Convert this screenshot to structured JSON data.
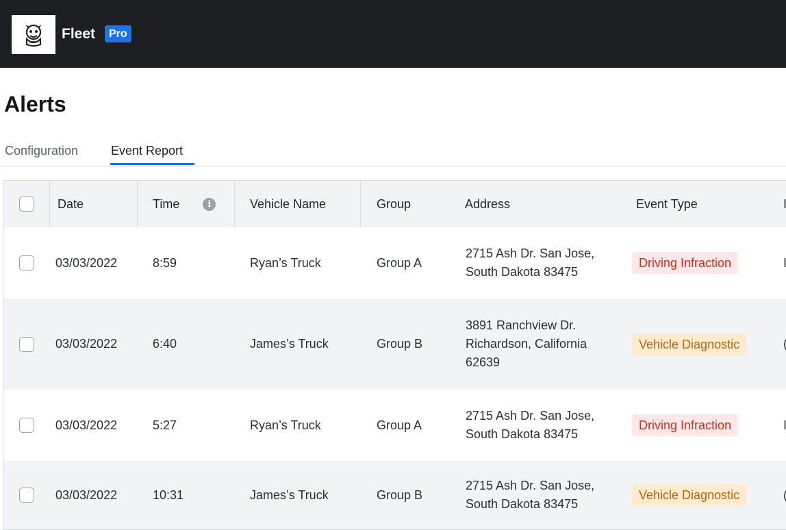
{
  "header": {
    "brand": "Fleet",
    "badge": "Pro",
    "logo_icon": "mascot-logo-icon",
    "bg_color": "#1c1e21",
    "badge_color": "#1a73e8"
  },
  "page": {
    "title": "Alerts"
  },
  "tabs": [
    {
      "label": "Configuration",
      "active": false
    },
    {
      "label": "Event Report",
      "active": true
    }
  ],
  "table": {
    "columns": [
      "Date",
      "Time",
      "Vehicle Name",
      "Group",
      "Address",
      "Event Type"
    ],
    "time_info_icon": "info-icon",
    "rows": [
      {
        "date": "03/03/2022",
        "time": "8:59",
        "vehicle": "Ryan’s Truck",
        "group": "Group A",
        "address": "2715 Ash Dr. San Jose, South Dakota 83475",
        "event": "Driving Infraction",
        "event_kind": "red",
        "next": "I"
      },
      {
        "date": "03/03/2022",
        "time": "6:40",
        "vehicle": "James’s Truck",
        "group": "Group B",
        "address": "3891 Ranchview Dr. Richardson, California 62639",
        "event": "Vehicle Diagnostic",
        "event_kind": "amber",
        "next": "("
      },
      {
        "date": "03/03/2022",
        "time": "5:27",
        "vehicle": "Ryan’s Truck",
        "group": "Group A",
        "address": "2715 Ash Dr. San Jose, South Dakota 83475",
        "event": "Driving Infraction",
        "event_kind": "red",
        "next": "I"
      },
      {
        "date": "03/03/2022",
        "time": "10:31",
        "vehicle": "James’s Truck",
        "group": "Group B",
        "address": "2715 Ash Dr. San Jose, South Dakota 83475",
        "event": "Vehicle Diagnostic",
        "event_kind": "amber",
        "next": "("
      }
    ],
    "header_next": "I"
  }
}
